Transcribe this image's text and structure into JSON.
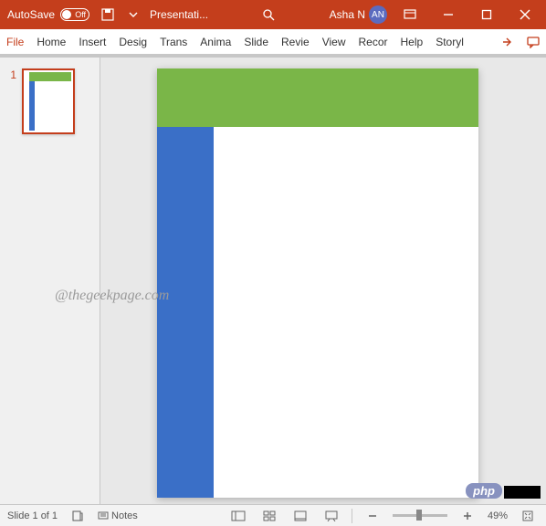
{
  "titlebar": {
    "autosave_label": "AutoSave",
    "autosave_state": "Off",
    "filename": "Presentati...",
    "user_name": "Asha N",
    "user_initials": "AN"
  },
  "ribbon": {
    "tabs": [
      "File",
      "Home",
      "Insert",
      "Desig",
      "Trans",
      "Anima",
      "Slide",
      "Revie",
      "View",
      "Recor",
      "Help",
      "Storyl"
    ]
  },
  "thumb": {
    "num": "1"
  },
  "watermark": "@thegeekpage.com",
  "badge": "php",
  "status": {
    "slide_info": "Slide 1 of 1",
    "notes_label": "Notes",
    "zoom_value": "49%"
  }
}
